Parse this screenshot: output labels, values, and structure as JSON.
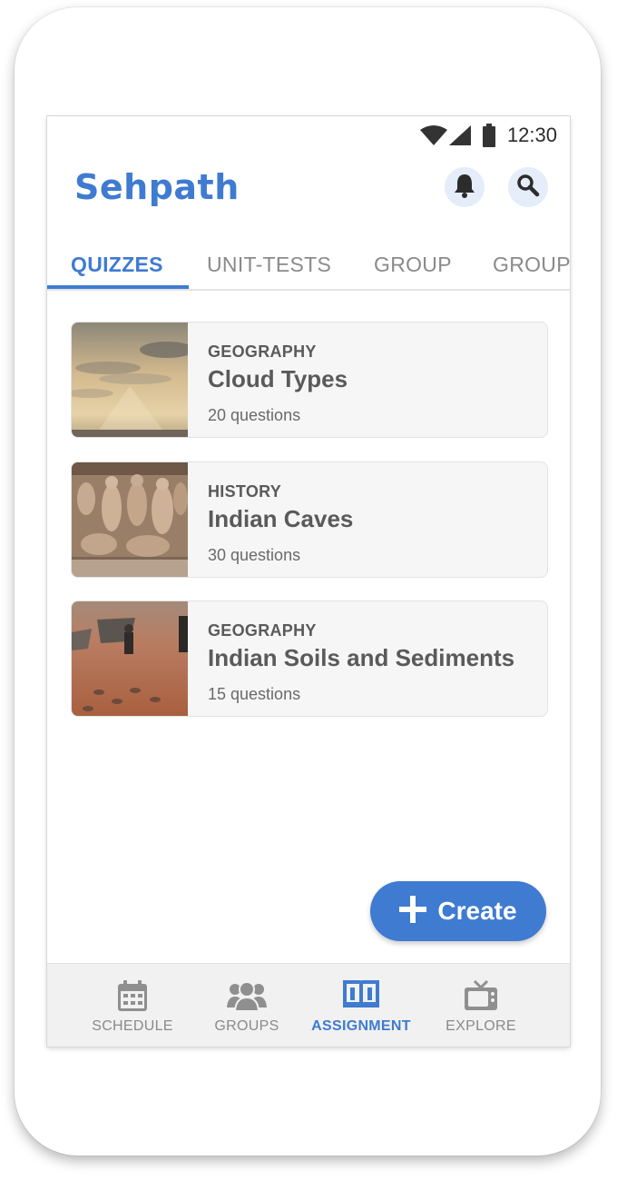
{
  "status_bar": {
    "time": "12:30"
  },
  "header": {
    "app_name": "Sehpath"
  },
  "tabs": [
    {
      "label": "QUIZZES",
      "active": true
    },
    {
      "label": "UNIT-TESTS",
      "active": false
    },
    {
      "label": "GROUP",
      "active": false
    },
    {
      "label": "GROUP",
      "active": false
    }
  ],
  "quizzes": [
    {
      "subject": "GEOGRAPHY",
      "title": "Cloud Types",
      "questions": "20 questions"
    },
    {
      "subject": "HISTORY",
      "title": "Indian Caves",
      "questions": "30 questions"
    },
    {
      "subject": "GEOGRAPHY",
      "title": "Indian Soils and Sediments",
      "questions": "15 questions"
    }
  ],
  "create_button": {
    "label": "Create",
    "icon": "plus-icon"
  },
  "bottom_nav": [
    {
      "label": "SCHEDULE",
      "icon": "calendar-icon",
      "active": false
    },
    {
      "label": "GROUPS",
      "icon": "people-icon",
      "active": false
    },
    {
      "label": "ASSIGNMENT",
      "icon": "book-icon",
      "active": true
    },
    {
      "label": "EXPLORE",
      "icon": "tv-icon",
      "active": false
    }
  ],
  "colors": {
    "accent": "#3f7bd0",
    "inactive": "#8a8a8a"
  }
}
